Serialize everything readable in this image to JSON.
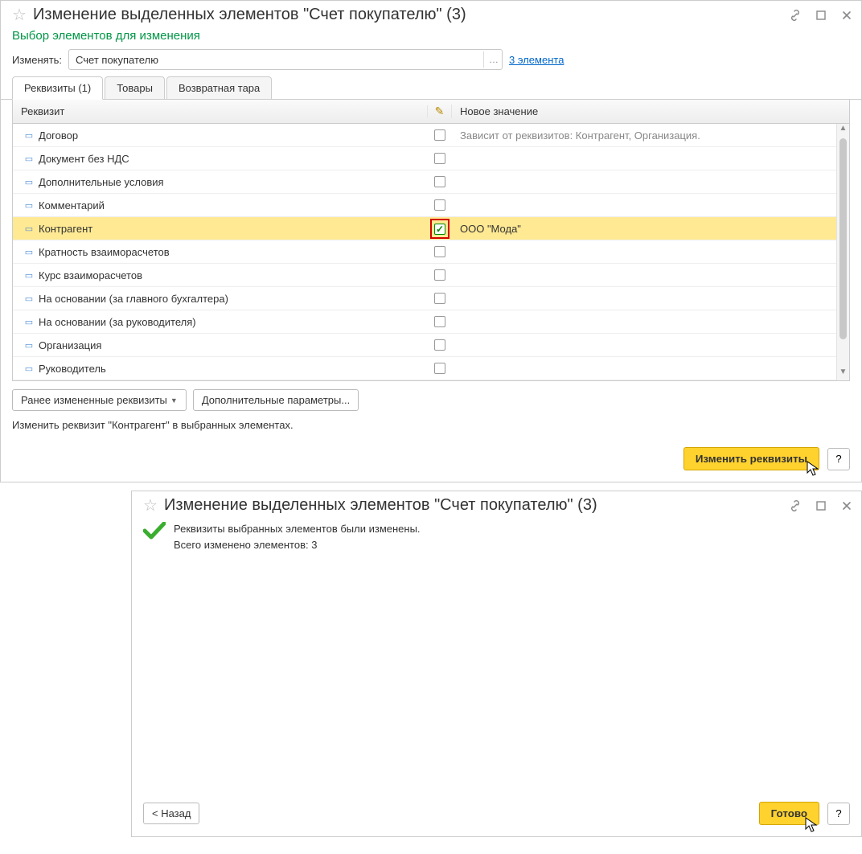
{
  "win1": {
    "title": "Изменение выделенных элементов \"Счет покупателю\" (3)",
    "subtitle": "Выбор элементов для изменения",
    "change_label": "Изменять:",
    "change_value": "Счет покупателю",
    "elements_link": "3 элемента",
    "tabs": {
      "t0": "Реквизиты (1)",
      "t1": "Товары",
      "t2": "Возвратная тара"
    },
    "grid_header": {
      "c1": "Реквизит",
      "c3": "Новое значение"
    },
    "rows": {
      "r0": {
        "label": "Договор",
        "val": "Зависит от реквизитов: Контрагент, Организация."
      },
      "r1": {
        "label": "Документ без НДС",
        "val": ""
      },
      "r2": {
        "label": "Дополнительные условия",
        "val": ""
      },
      "r3": {
        "label": "Комментарий",
        "val": ""
      },
      "r4": {
        "label": "Контрагент",
        "val": "ООО \"Мода\""
      },
      "r5": {
        "label": "Кратность взаиморасчетов",
        "val": ""
      },
      "r6": {
        "label": "Курс взаиморасчетов",
        "val": ""
      },
      "r7": {
        "label": "На основании (за главного бухгалтера)",
        "val": ""
      },
      "r8": {
        "label": "На основании (за руководителя)",
        "val": ""
      },
      "r9": {
        "label": "Организация",
        "val": ""
      },
      "r10": {
        "label": "Руководитель",
        "val": ""
      }
    },
    "btn_prev": "Ранее измененные реквизиты",
    "btn_extra": "Дополнительные параметры...",
    "status": "Изменить реквизит \"Контрагент\" в выбранных элементах.",
    "btn_apply": "Изменить реквизиты",
    "btn_help": "?"
  },
  "win2": {
    "title": "Изменение выделенных элементов \"Счет покупателю\" (3)",
    "msg1": "Реквизиты выбранных элементов были изменены.",
    "msg2": "Всего изменено элементов: 3",
    "btn_back": "< Назад",
    "btn_done": "Готово",
    "btn_help": "?"
  }
}
